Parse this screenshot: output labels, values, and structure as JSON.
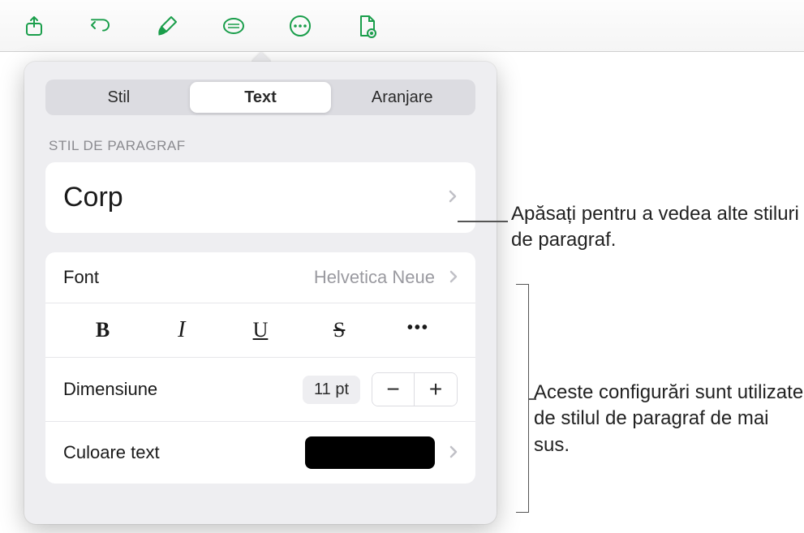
{
  "toolbar": {
    "icons": [
      "share",
      "undo",
      "format",
      "insert",
      "more",
      "document"
    ]
  },
  "tabs": {
    "items": [
      "Stil",
      "Text",
      "Aranjare"
    ],
    "selected": 1
  },
  "paragraph": {
    "section_label": "STIL DE PARAGRAF",
    "style_name": "Corp"
  },
  "font": {
    "label": "Font",
    "value": "Helvetica Neue"
  },
  "style_buttons": {
    "bold": "B",
    "italic": "I",
    "underline": "U",
    "strike": "S",
    "more": "•••"
  },
  "size": {
    "label": "Dimensiune",
    "value": "11 pt",
    "decrease": "−",
    "increase": "+"
  },
  "text_color": {
    "label": "Culoare text",
    "value": "#000000"
  },
  "annotations": {
    "a1": "Apăsați pentru a vedea alte stiluri de paragraf.",
    "a2": "Aceste configurări sunt utilizate de stilul de paragraf de mai sus."
  }
}
